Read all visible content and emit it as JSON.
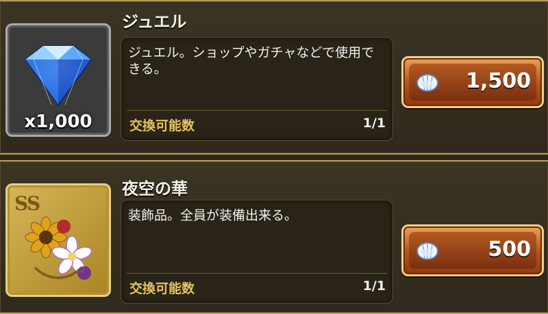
{
  "items": [
    {
      "name": "ジュエル",
      "quantity": "x1,000",
      "description": "ジュエル。ショップやガチャなどで使用できる。",
      "exchange_label": "交換可能数",
      "exchange_count": "1/1",
      "price": "1,500",
      "icon": "jewel-diamond"
    },
    {
      "name": "夜空の華",
      "quantity": "",
      "description": "装飾品。全員が装備出来る。",
      "exchange_label": "交換可能数",
      "exchange_count": "1/1",
      "price": "500",
      "icon": "flower-ornament"
    }
  ],
  "theme": {
    "title_color": "#f4f1e6",
    "label_color": "#e7c164",
    "button_color": "#b85218",
    "frame_gold": "#b79a5c"
  }
}
